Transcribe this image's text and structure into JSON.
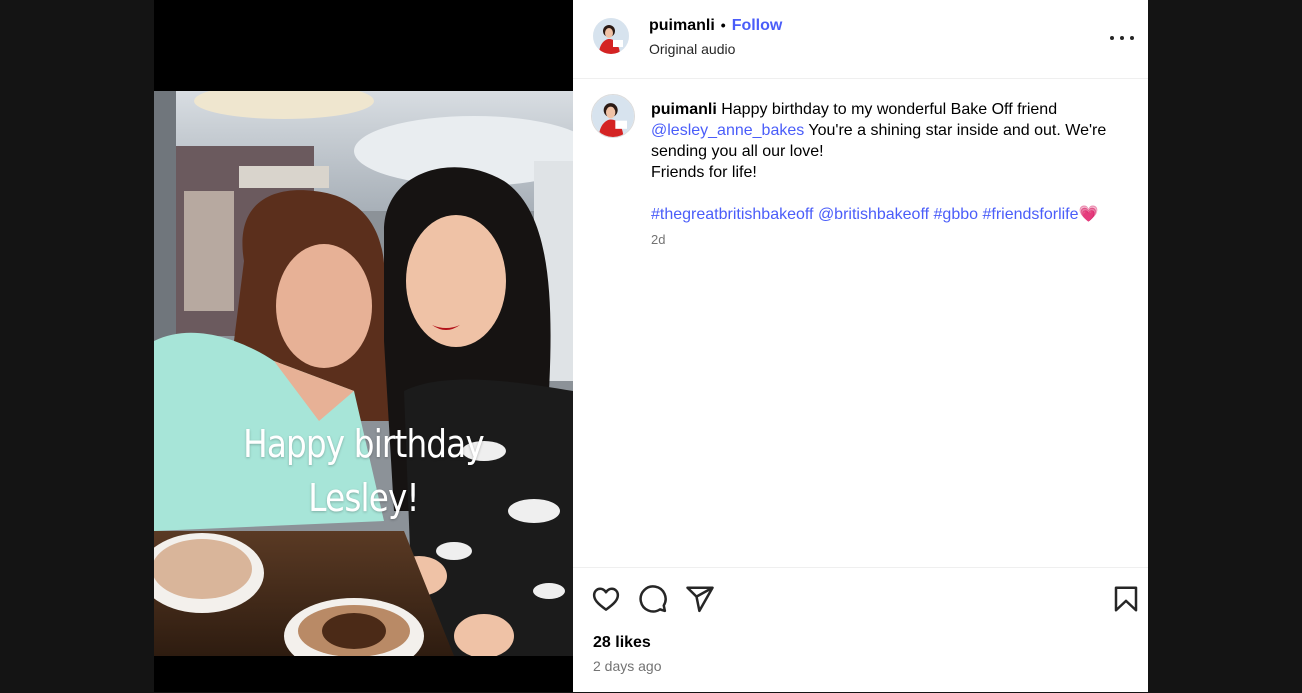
{
  "post": {
    "author": "puimanli",
    "follow_label": "Follow",
    "separator": "•",
    "audio": "Original audio",
    "caption": {
      "username": "puimanli",
      "text_1": " Happy birthday to my wonderful Bake Off friend ",
      "mention": "@lesley_anne_bakes",
      "text_2": " You're a shining star inside and out. We're sending you all our love!",
      "line_2": "Friends for life!",
      "hashtags": [
        "#thegreatbritishbakeoff",
        "@britishbakeoff",
        "#gbbo",
        "#friendsforlife"
      ],
      "emoji": "💗"
    },
    "posted_time": "2d",
    "likes": "28 likes",
    "date_label": "2 days ago"
  },
  "media": {
    "overlay_line_1": "Happy birthday",
    "overlay_line_2": "Lesley!"
  },
  "icons": {
    "like": "heart-icon",
    "comment": "comment-bubble-icon",
    "share": "paper-plane-icon",
    "save": "bookmark-icon",
    "more": "more-options-icon"
  },
  "colors": {
    "link": "#4a5df9",
    "background": "#141414",
    "panel": "#ffffff",
    "muted": "#737373"
  }
}
